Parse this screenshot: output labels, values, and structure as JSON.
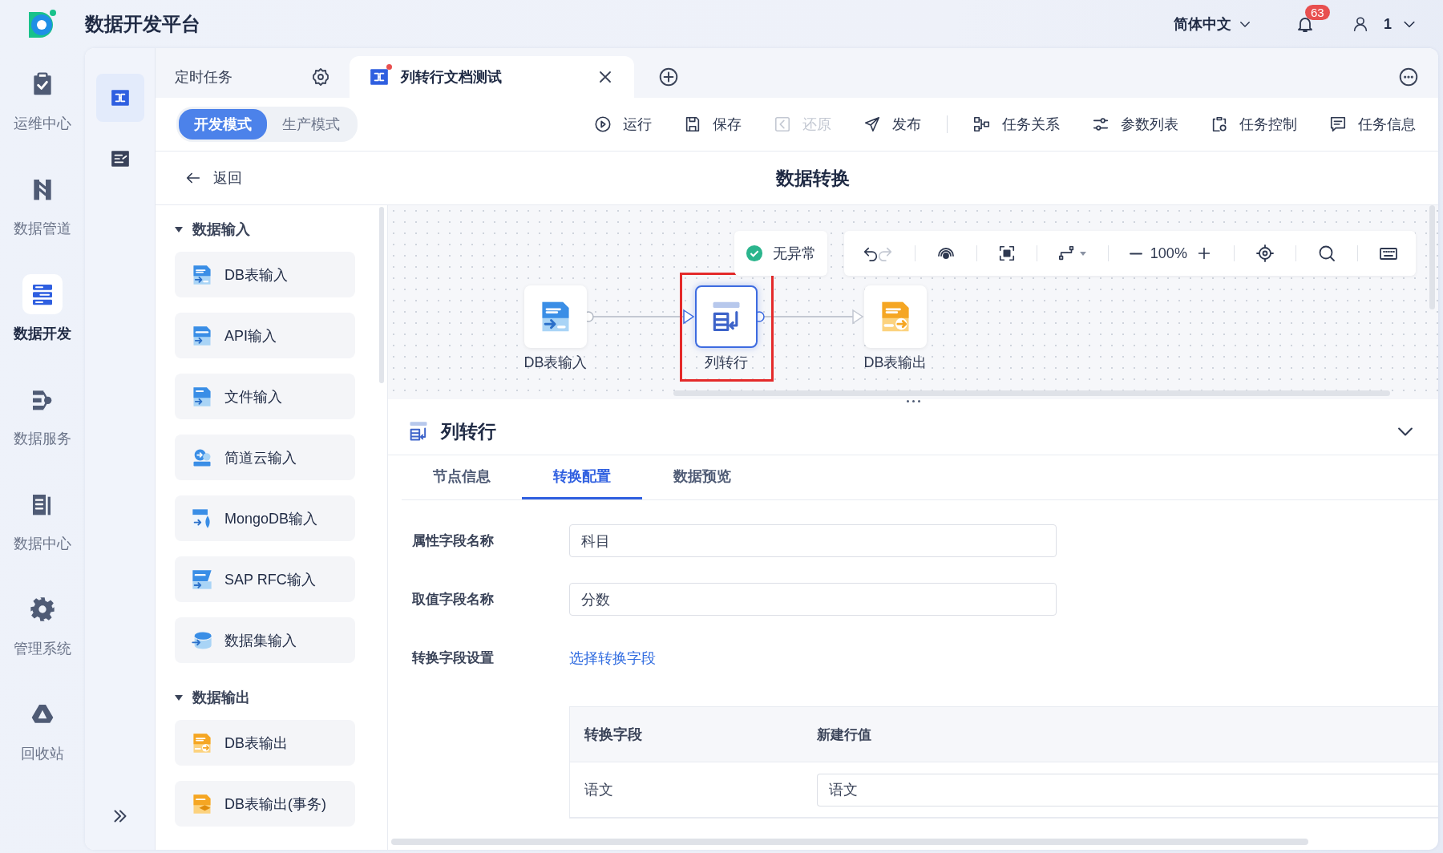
{
  "app": {
    "title": "数据开发平台"
  },
  "header": {
    "language": "简体中文",
    "notifications": "63",
    "user": "1"
  },
  "nav": [
    {
      "label": "运维中心",
      "kind": "clipboard",
      "selected": false
    },
    {
      "label": "数据管道",
      "kind": "pipe",
      "selected": false
    },
    {
      "label": "数据开发",
      "kind": "dev",
      "selected": true
    },
    {
      "label": "数据服务",
      "kind": "service",
      "selected": false
    },
    {
      "label": "数据中心",
      "kind": "bars",
      "selected": false
    },
    {
      "label": "管理系统",
      "kind": "gear",
      "selected": false
    },
    {
      "label": "回收站",
      "kind": "recycle",
      "selected": false
    }
  ],
  "tools": [
    {
      "kind": "flow",
      "selected": true
    },
    {
      "kind": "list",
      "selected": false
    }
  ],
  "tabs": [
    {
      "label": "定时任务",
      "kind": "settings",
      "selected": false
    },
    {
      "label": "列转行文档测试",
      "kind": "task",
      "selected": true
    }
  ],
  "modes": [
    {
      "label": "开发模式",
      "selected": true
    },
    {
      "label": "生产模式",
      "selected": false
    }
  ],
  "actions": [
    {
      "label": "运行",
      "kind": "run",
      "disabled": false
    },
    {
      "label": "保存",
      "kind": "save",
      "disabled": false
    },
    {
      "label": "还原",
      "kind": "restore",
      "disabled": true
    },
    {
      "label": "发布",
      "kind": "publish",
      "disabled": false
    },
    {
      "label": "任务关系",
      "kind": "relation",
      "disabled": false
    },
    {
      "label": "参数列表",
      "kind": "params",
      "disabled": false
    },
    {
      "label": "任务控制",
      "kind": "control",
      "disabled": false
    },
    {
      "label": "任务信息",
      "kind": "info",
      "disabled": false
    }
  ],
  "page": {
    "back": "返回",
    "title": "数据转换"
  },
  "palette": [
    {
      "title": "数据输入",
      "expanded": true,
      "items": [
        {
          "label": "DB表输入",
          "kind": "db-in"
        },
        {
          "label": "API输入",
          "kind": "api"
        },
        {
          "label": "文件输入",
          "kind": "file"
        },
        {
          "label": "简道云输入",
          "kind": "cloud"
        },
        {
          "label": "MongoDB输入",
          "kind": "mongo"
        },
        {
          "label": "SAP RFC输入",
          "kind": "sap"
        },
        {
          "label": "数据集输入",
          "kind": "dataset"
        }
      ]
    },
    {
      "title": "数据输出",
      "expanded": true,
      "items": [
        {
          "label": "DB表输出",
          "kind": "db-out"
        },
        {
          "label": "DB表输出(事务)",
          "kind": "db-tx"
        }
      ]
    }
  ],
  "canvas": {
    "status": "无异常",
    "zoom": "100%",
    "nodes": [
      {
        "label": "DB表输入",
        "kind": "db-in",
        "selected": false
      },
      {
        "label": "列转行",
        "kind": "transform",
        "selected": true
      },
      {
        "label": "DB表输出",
        "kind": "db-out",
        "selected": false
      }
    ]
  },
  "panel": {
    "title": "列转行",
    "expanded": true,
    "tabs": [
      {
        "label": "节点信息",
        "selected": false
      },
      {
        "label": "转换配置",
        "selected": true
      },
      {
        "label": "数据预览",
        "selected": false
      }
    ],
    "fields": [
      {
        "label": "属性字段名称",
        "kind": "input",
        "value": "科目"
      },
      {
        "label": "取值字段名称",
        "kind": "input",
        "value": "分数"
      },
      {
        "label": "转换字段设置",
        "kind": "link",
        "value": "选择转换字段"
      }
    ],
    "table": {
      "columns": [
        "转换字段",
        "新建行值"
      ],
      "rows": [
        {
          "field": "语文",
          "value": "语文"
        }
      ]
    }
  }
}
